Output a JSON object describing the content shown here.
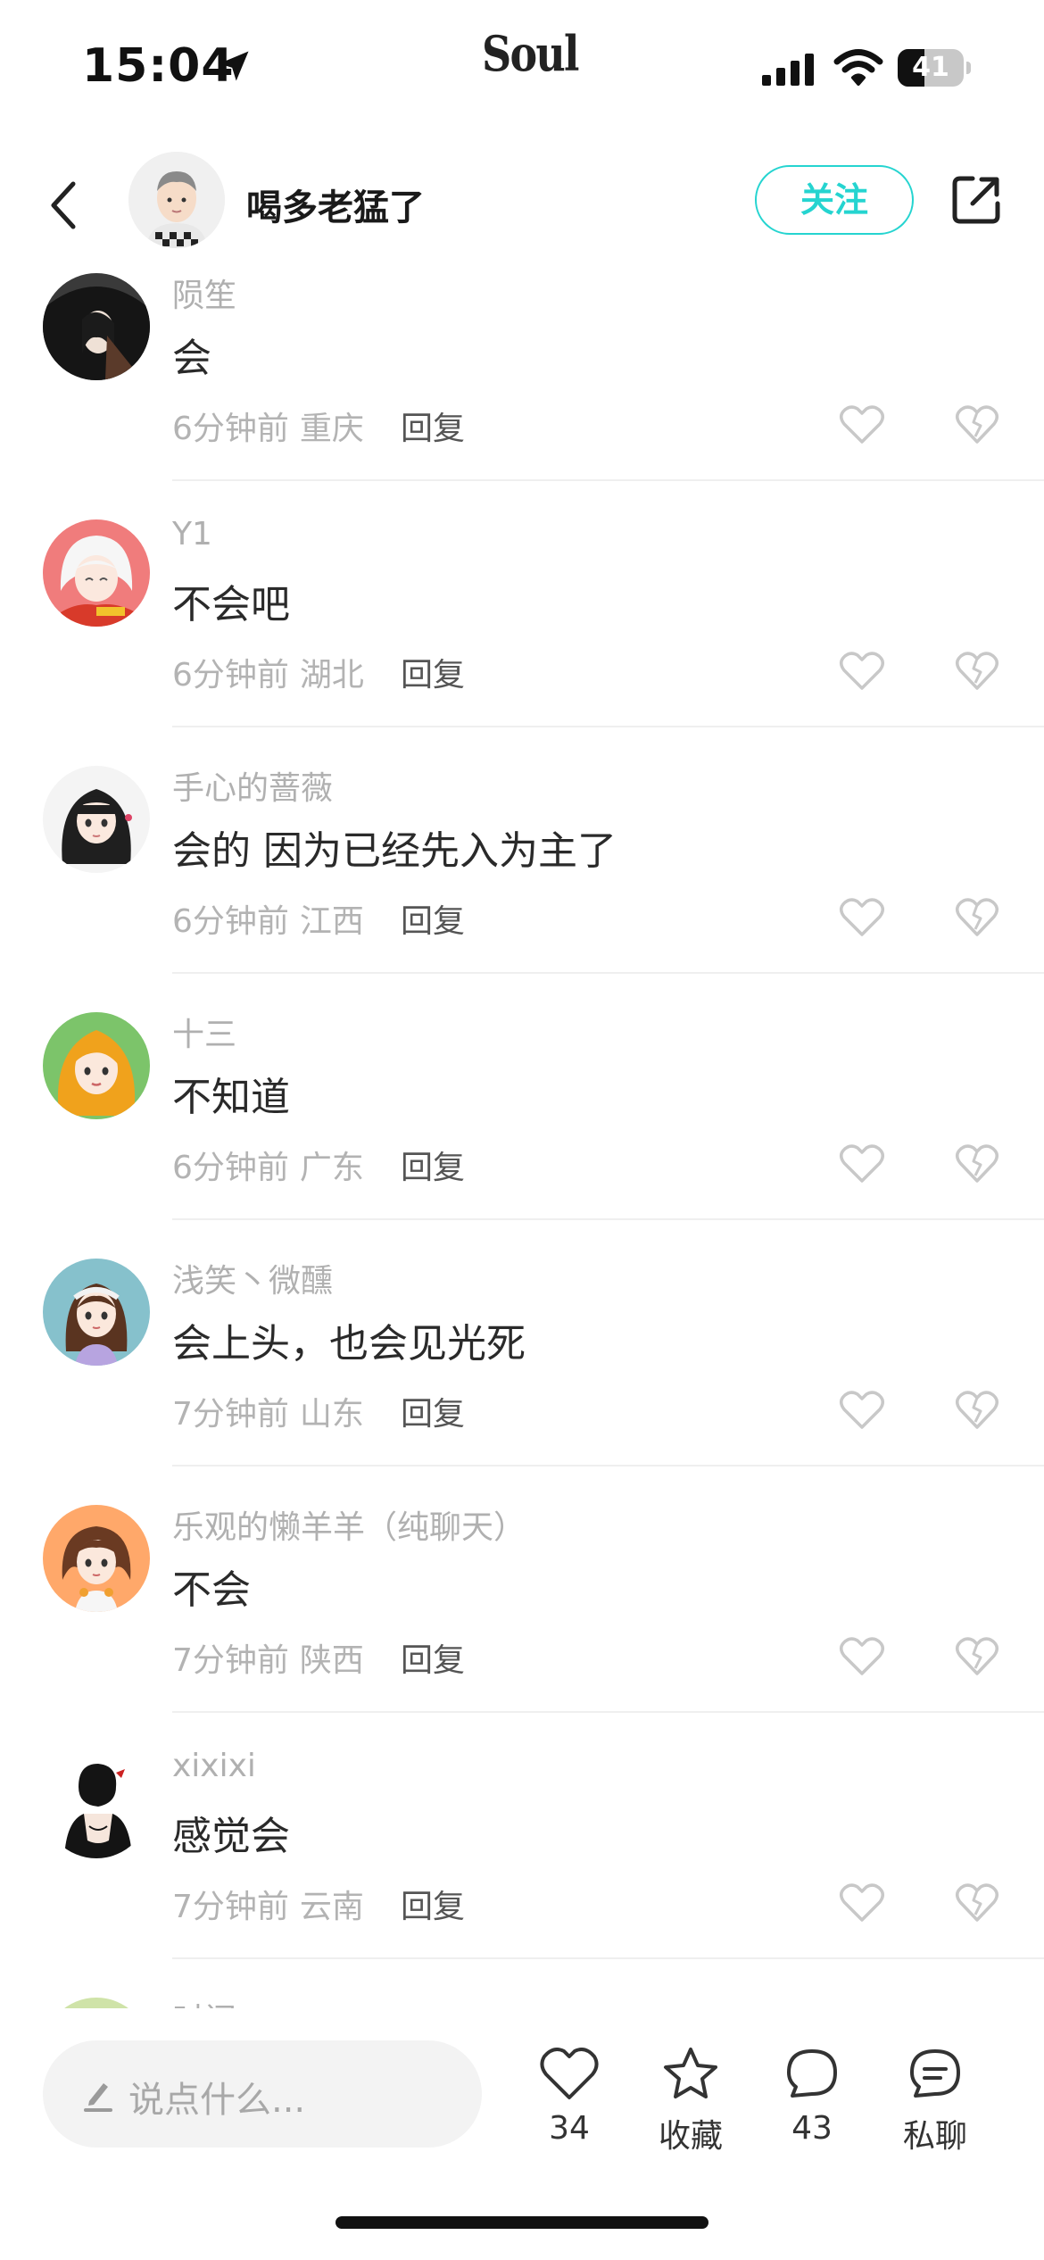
{
  "status_bar": {
    "time": "15:04",
    "app_logo": "Soul",
    "battery_level": "41",
    "battery_fraction": 0.41
  },
  "header": {
    "username": "喝多老猛了",
    "follow_label": "关注",
    "accent_color": "#25d4d0"
  },
  "comments": [
    {
      "user": "陨笙",
      "text": "会",
      "time": "6分钟前",
      "location": "重庆",
      "reply_label": "回复"
    },
    {
      "user": "Y1",
      "text": "不会吧",
      "time": "6分钟前",
      "location": "湖北",
      "reply_label": "回复"
    },
    {
      "user": "手心的蔷薇",
      "text": "会的 因为已经先入为主了",
      "time": "6分钟前",
      "location": "江西",
      "reply_label": "回复"
    },
    {
      "user": "十三",
      "text": "不知道",
      "time": "6分钟前",
      "location": "广东",
      "reply_label": "回复"
    },
    {
      "user": "浅笑丶微醺",
      "text": "会上头，也会见光死",
      "time": "7分钟前",
      "location": "山东",
      "reply_label": "回复"
    },
    {
      "user": "乐观的懒羊羊（纯聊天）",
      "text": "不会",
      "time": "7分钟前",
      "location": "陕西",
      "reply_label": "回复"
    },
    {
      "user": "xixixi",
      "text": "感觉会",
      "time": "7分钟前",
      "location": "云南",
      "reply_label": "回复"
    },
    {
      "user": "时间",
      "text": "",
      "time": "",
      "location": "",
      "reply_label": ""
    }
  ],
  "bottom_bar": {
    "input_placeholder": "说点什么...",
    "like_count": "34",
    "collect_label": "收藏",
    "comment_count": "43",
    "chat_label": "私聊"
  }
}
